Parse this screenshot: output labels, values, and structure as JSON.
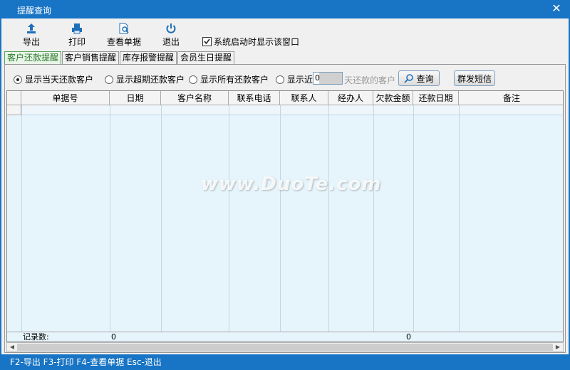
{
  "window": {
    "title": "提醒查询"
  },
  "toolbar": {
    "export_label": "导出",
    "print_label": "打印",
    "view_doc_label": "查看单据",
    "exit_label": "退出",
    "startup_checkbox_label": "系统启动时显示该窗口",
    "startup_checked": true
  },
  "tabs": [
    {
      "label": "客户还款提醒",
      "active": true
    },
    {
      "label": "客户销售提醒",
      "active": false
    },
    {
      "label": "库存报警提醒",
      "active": false
    },
    {
      "label": "会员生日提醒",
      "active": false
    }
  ],
  "filters": {
    "options": [
      {
        "label": "显示当天还款客户",
        "selected": true
      },
      {
        "label": "显示超期还款客户",
        "selected": false
      },
      {
        "label": "显示所有还款客户",
        "selected": false
      },
      {
        "label": "显示近",
        "selected": false
      }
    ],
    "days_value": "0",
    "days_suffix": "天还款的客户",
    "query_label": "查询",
    "sms_label": "群发短信"
  },
  "grid": {
    "columns": [
      "单据号",
      "日期",
      "客户名称",
      "联系电话",
      "联系人",
      "经办人",
      "欠款金额",
      "还款日期",
      "备注"
    ],
    "footer": {
      "record_label": "记录数:",
      "record_count": "0",
      "debt_total": "0"
    }
  },
  "statusbar": {
    "text": "F2-导出 F3-打印 F4-查看单据 Esc-退出"
  },
  "watermark": {
    "text": "www.DuoTe.com"
  }
}
